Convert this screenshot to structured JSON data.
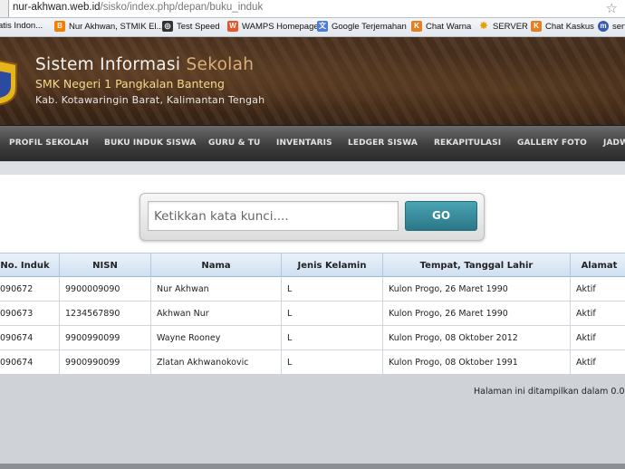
{
  "browser": {
    "url_host": "nur-akhwan.web.id",
    "url_path": "/sisko/index.php/depan/buku_induk",
    "bookmarks": [
      {
        "label": "atis Indon...",
        "icon": "bookmark-page-icon",
        "color": "#6a8e2e"
      },
      {
        "label": "Nur Akhwan, STMIK El...",
        "icon": "blogger-icon",
        "color": "#f57d00"
      },
      {
        "label": "Test Speed",
        "icon": "speedtest-icon",
        "color": "#333333"
      },
      {
        "label": "WAMPS Homepage",
        "icon": "wamp-icon",
        "color": "#e8552b"
      },
      {
        "label": "Google Terjemahan",
        "icon": "google-translate-icon",
        "color": "#4a7bd8"
      },
      {
        "label": "Chat Warna",
        "icon": "kaskus-icon",
        "color": "#e67e22"
      },
      {
        "label": "SERVER",
        "icon": "star-bookmark-icon",
        "color": "#e6a100"
      },
      {
        "label": "Chat Kaskus",
        "icon": "kaskus-icon",
        "color": "#e67e22"
      },
      {
        "label": "sert",
        "icon": "bookmark-site-icon",
        "color": "#3a5bb5"
      }
    ]
  },
  "header": {
    "title_main": "Sistem Informasi ",
    "title_accent": "Sekolah",
    "subtitle": "SMK Negeri 1 Pangkalan Banteng",
    "location": "Kab. Kotawaringin Barat, Kalimantan Tengah"
  },
  "nav": [
    "PROFIL SEKOLAH",
    "BUKU INDUK SISWA",
    "GURU & TU",
    "INVENTARIS",
    "LEDGER SISWA",
    "REKAPITULASI",
    "GALLERY FOTO",
    "JADWAL"
  ],
  "search": {
    "placeholder": "Ketikkan kata kunci....",
    "button_label": "GO"
  },
  "table": {
    "headers": [
      "No. Induk",
      "NISN",
      "Nama",
      "Jenis Kelamin",
      "Tempat, Tanggal Lahir",
      "Alamat"
    ],
    "rows": [
      [
        "090672",
        "9900009090",
        "Nur Akhwan",
        "L",
        "Kulon Progo, 26 Maret 1990",
        "Aktif"
      ],
      [
        "090673",
        "1234567890",
        "Akhwan Nur",
        "L",
        "Kulon Progo, 26 Maret 1990",
        "Aktif"
      ],
      [
        "090674",
        "9900990099",
        "Wayne Rooney",
        "L",
        "Kulon Progo, 08 Oktober 2012",
        "Aktif"
      ],
      [
        "090674",
        "9900990099",
        "Zlatan Akhwanokovic",
        "L",
        "Kulon Progo, 08 Oktober 1991",
        "Aktif"
      ]
    ]
  },
  "footer": {
    "note": "Halaman ini ditampilkan dalam 0.0"
  }
}
